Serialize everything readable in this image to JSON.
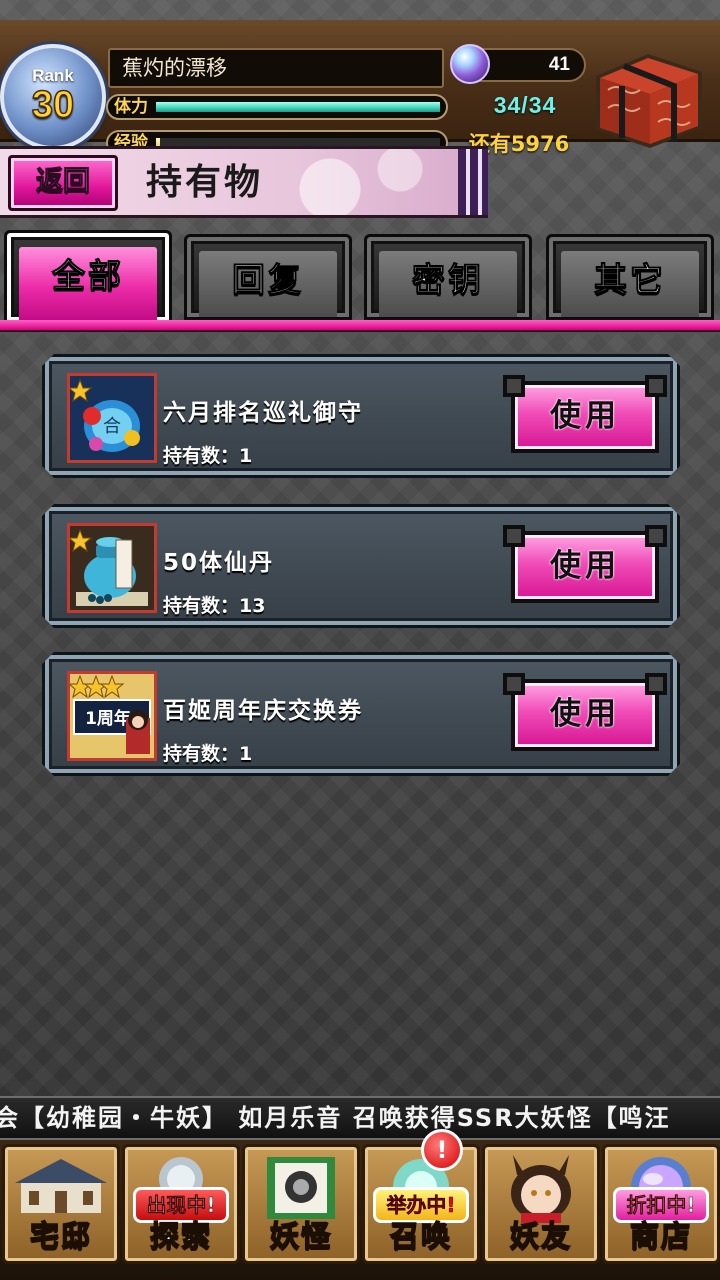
{
  "header": {
    "rank_label": "Rank",
    "rank_value": "30",
    "player_name": "蕉灼的漂移",
    "orb_count": "41",
    "stamina_label": "体力",
    "stamina_value": "34/34",
    "stamina_fraction": 1.0,
    "exp_label": "经验",
    "exp_remaining": "还有5976",
    "exp_fraction": 0.01
  },
  "title_bar": {
    "back_label": "返回",
    "title": "持有物"
  },
  "tabs": [
    {
      "label": "全部",
      "active": true
    },
    {
      "label": "回复",
      "active": false
    },
    {
      "label": "密钥",
      "active": false
    },
    {
      "label": "其它",
      "active": false
    }
  ],
  "items": [
    {
      "name": "六月排名巡礼御守",
      "count_text": "持有数：1",
      "use_label": "使用",
      "stars": 1,
      "icon": "amulet-icon"
    },
    {
      "name": "50体仙丹",
      "count_text": "持有数：13",
      "use_label": "使用",
      "stars": 1,
      "icon": "elixir-jar-icon"
    },
    {
      "name": "百姬周年庆交换券",
      "count_text": "持有数：1",
      "use_label": "使用",
      "stars": 3,
      "icon": "anniversary-ticket-icon"
    }
  ],
  "ticker": {
    "text": "会【幼稚园・牛妖】   如月乐音 召唤获得SSR大妖怪【鸣汪"
  },
  "bottom_nav": [
    {
      "label": "宅邸",
      "badge": "",
      "icon": "mansion-icon"
    },
    {
      "label": "探索",
      "badge": "出现中!",
      "icon": "explore-icon"
    },
    {
      "label": "妖怪",
      "badge": "",
      "icon": "youkai-scroll-icon"
    },
    {
      "label": "召唤",
      "badge": "举办中!",
      "icon": "summon-icon",
      "alert": "!"
    },
    {
      "label": "妖友",
      "badge": "",
      "icon": "friend-icon"
    },
    {
      "label": "商店",
      "badge": "折扣中!",
      "icon": "shop-icon"
    }
  ],
  "colors": {
    "accent_pink": "#ec2ba8",
    "stamina_teal": "#3fd0b8",
    "gold": "#ffd23a"
  }
}
